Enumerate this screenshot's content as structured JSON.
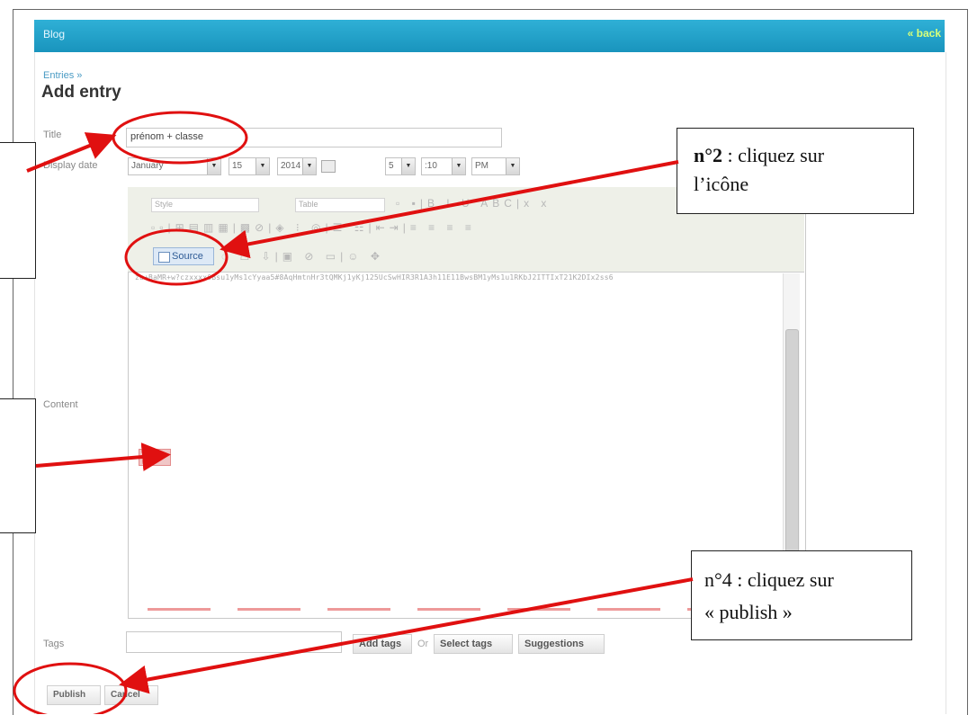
{
  "header": {
    "title": "Blog",
    "back_label": "« back"
  },
  "breadcrumb": "Entries »",
  "page_title": "Add entry",
  "form": {
    "title_label": "Title",
    "title_value": "prénom + classe",
    "display_date_label": "Display date",
    "month": "January",
    "day": "15",
    "year": "2014",
    "hour": "5",
    "minute": ":10",
    "ampm": "PM",
    "content_label": "Content",
    "tags_label": "Tags"
  },
  "editor": {
    "style_combo": "Style",
    "table_combo": "Table",
    "source_button": "Source",
    "content_text": "zu+BaMR+w?czxxxx6Bsu1yMs1cYyaa5#8AqHmtnHr3tQMKj1yKj125UcSwHIR3R1A3h11E11BwsBM1yMs1u1RKbJ2ITTIxT21K2DIx2ss6"
  },
  "tags": {
    "add_tags": "Add tags",
    "or": "Or",
    "select_tags": "Select tags",
    "suggestions": "Suggestions"
  },
  "actions": {
    "publish": "Publish",
    "cancel": "Cancel"
  },
  "annotations": {
    "n2_bold": "n°2",
    "n2_text": " : cliquez sur",
    "n2_text2": "l’icône",
    "n4_text": "n°4 : cliquez sur",
    "n4_text2": "« publish »"
  },
  "colors": {
    "header_blue": "#1994bd",
    "annotation_red": "#e01010",
    "back_green": "#d8ff7a"
  }
}
